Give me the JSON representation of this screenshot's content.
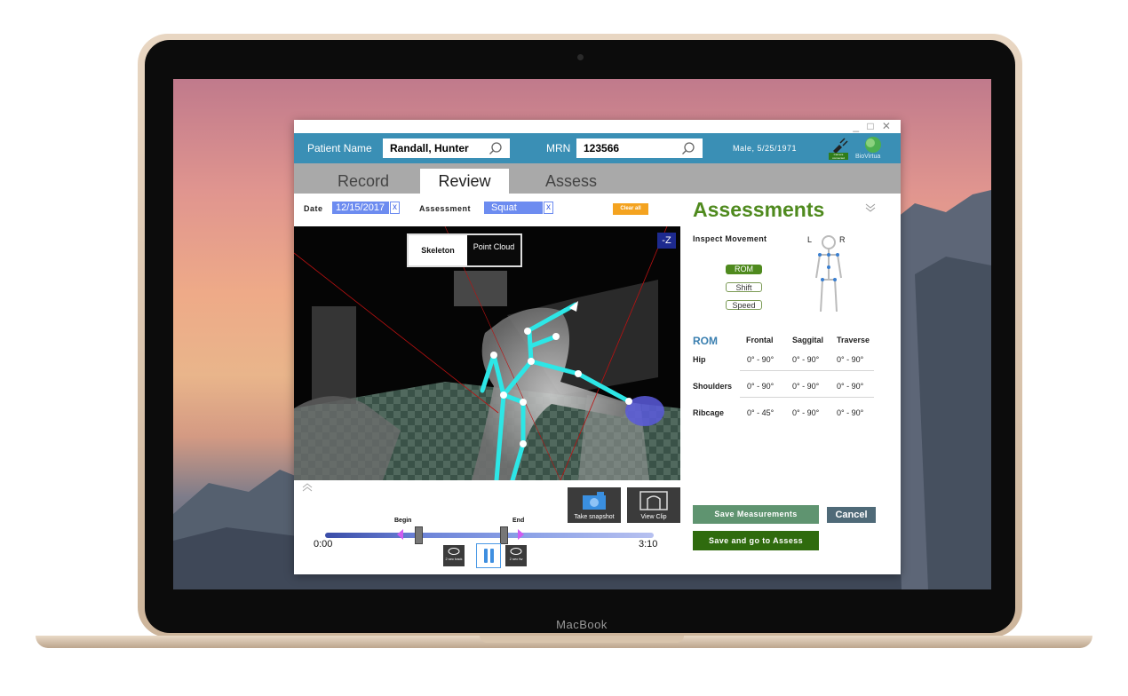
{
  "device": {
    "label": "MacBook"
  },
  "window": {
    "controls": "_ □ ✕"
  },
  "header": {
    "patient_name_label": "Patient Name",
    "patient_name_value": "Randall, Hunter",
    "mrn_label": "MRN",
    "mrn_value": "123566",
    "patient_info": "Male, 5/25/1971",
    "camera_status": "Camera connected",
    "logo_text": "BioVirtua"
  },
  "tabs": [
    {
      "label": "Record",
      "active": false
    },
    {
      "label": "Review",
      "active": true
    },
    {
      "label": "Assess",
      "active": false
    }
  ],
  "filters": {
    "date_label": "Date",
    "date_value": "12/15/2017",
    "assessment_label": "Assessment",
    "assessment_value": "Squat",
    "remove_symbol": "x",
    "clear_all": "Clear all"
  },
  "viewer": {
    "toggle": [
      "Skeleton",
      "Point Cloud"
    ],
    "axis_label": "-Z"
  },
  "playback": {
    "snapshot_label": "Take snapshot",
    "view_clip_label": "View Clip",
    "begin_label": "Begin",
    "end_label": "End",
    "start_time": "0:00",
    "end_time": "3:10",
    "back_label": "2 sec back",
    "fwd_label": "2 sec fw"
  },
  "assessments": {
    "title": "Assessments",
    "inspect_label": "Inspect Movement",
    "left_label": "L",
    "right_label": "R",
    "modes": [
      {
        "label": "ROM",
        "active": true
      },
      {
        "label": "Shift",
        "active": false
      },
      {
        "label": "Speed",
        "active": false
      }
    ],
    "table_title": "ROM",
    "columns": [
      "Frontal",
      "Saggital",
      "Traverse"
    ],
    "rows": [
      {
        "name": "Hip",
        "values": [
          "0° - 90°",
          "0° - 90°",
          "0° - 90°"
        ]
      },
      {
        "name": "Shoulders",
        "values": [
          "0° - 90°",
          "0° - 90°",
          "0° - 90°"
        ]
      },
      {
        "name": "Ribcage",
        "values": [
          "0° - 45°",
          "0° - 90°",
          "0° - 90°"
        ]
      }
    ],
    "save_label": "Save Measurements",
    "cancel_label": "Cancel",
    "save_go_label": "Save and go to Assess"
  },
  "colors": {
    "header_bg": "#3a8fb5",
    "tabs_bg": "#a9a9a9",
    "accent_green": "#4f8a1e",
    "skeleton": "#2de6e6",
    "chip_blue": "#6d8cf0",
    "clear_orange": "#f4a320"
  }
}
